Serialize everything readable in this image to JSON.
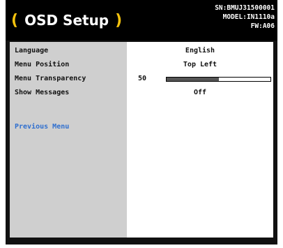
{
  "header": {
    "title": "OSD Setup",
    "paren_left": "(",
    "paren_right": ")",
    "serial": "SN:BMUJ31500001",
    "model": "MODEL:IN1110a",
    "firmware": "FW:A06"
  },
  "menu": {
    "items": [
      {
        "label": "Language",
        "value": "English"
      },
      {
        "label": "Menu Position",
        "value": "Top Left"
      },
      {
        "label": "Menu Transparency",
        "value": "50",
        "fraction": 0.5
      },
      {
        "label": "Show Messages",
        "value": "Off"
      }
    ],
    "previous_menu": "Previous Menu"
  },
  "colors": {
    "accent": "#f4c20d",
    "link": "#2f6fcf",
    "panel_left": "#cfcfcf",
    "header_bg": "#000000"
  }
}
